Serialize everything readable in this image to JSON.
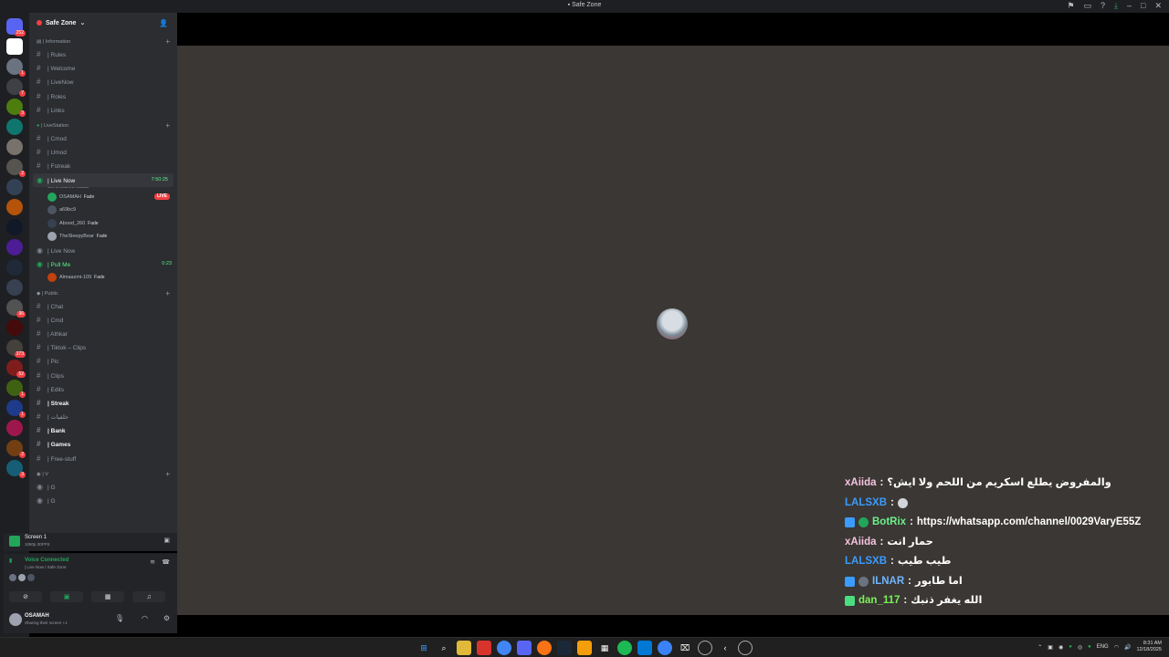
{
  "window": {
    "title": "Safe Zone",
    "title_icon": "discord-icon"
  },
  "server": {
    "name": "Safe Zone"
  },
  "servers_sidebar": {
    "badges": [
      "252",
      "1",
      "7",
      "3",
      "2",
      "96",
      "2",
      "373",
      "52",
      "1",
      "1",
      "2",
      "3"
    ]
  },
  "categories": {
    "information": {
      "label": "| Information"
    },
    "livestation": {
      "label": "| LiveStation"
    },
    "public": {
      "label": "| Public"
    },
    "v": {
      "label": "| V"
    }
  },
  "channels": {
    "rules": "| Rules",
    "welcome": "| Welcome",
    "livenow_text": "| LiveNow",
    "roles": "| Roles",
    "links": "| Links",
    "cmod": "| Cmod",
    "umod": "| Umod",
    "fstreak": "| Fstreak",
    "live_now_voice": "| Live Now",
    "live_now_status": "Set a channel status",
    "live_now_timer": "7:50:25",
    "live_now_2": "| Live Now",
    "pull_me": "| Pull Me",
    "pull_me_timer": "0:23",
    "chat": "| Chat",
    "cmd": "| Cmd",
    "athkar": "| Athkar",
    "tiktok": "| Tiktok – Clips",
    "pic": "| Pic",
    "clips": "| Clips",
    "edits": "| Edits",
    "streak": "| Streak",
    "arabic_channel": "| خلفيات",
    "bank": "| Bank",
    "games": "| Games",
    "free_stuff": "| Free-stuff",
    "g1": "| G",
    "g2": "| G"
  },
  "voice_users": {
    "u1": {
      "name": "OSAMAH",
      "tag": "Fade",
      "live": "LIVE"
    },
    "u2": {
      "name": "a69bc9",
      "tag": ""
    },
    "u3": {
      "name": "Abood_260",
      "tag": "Fade"
    },
    "u4": {
      "name": "TheSleepyBear",
      "tag": "Fade"
    },
    "u5": {
      "name": "Almaazmi-109",
      "tag": "Fade"
    }
  },
  "stream_panel": {
    "title": "Screen 1",
    "subtitle": "1080p 30FPS"
  },
  "voice_panel": {
    "status": "Voice Connected",
    "location": "| Live Now / Safe Zone"
  },
  "user_panel": {
    "username": "OSAMAH",
    "status": "Sharing their screen +1"
  },
  "stream_chat": [
    {
      "name": "xAiida",
      "name_color": "#f5c2e0",
      "text": "والمفروض يطلع اسكريم من اللحم ولا ايش؟"
    },
    {
      "name": "LALSXB",
      "name_color": "#3b9cff",
      "text": ""
    },
    {
      "name": "BotRix",
      "name_color": "#6df08a",
      "text": "https://whatsapp.com/channel/0029VaryE55Z"
    },
    {
      "name": "xAiida",
      "name_color": "#f5c2e0",
      "text": "حمار انت"
    },
    {
      "name": "LALSXB",
      "name_color": "#3b9cff",
      "text": "طيب طيب"
    },
    {
      "name": "ILNAR",
      "name_color": "#6fb6ff",
      "text": "اما طابور"
    },
    {
      "name": "dan_117",
      "name_color": "#7cf05a",
      "text": "الله يغفر ذنبك"
    }
  ],
  "taskbar": {
    "language": "ENG",
    "time": "8:31 AM",
    "date": "12/18/2025"
  },
  "colors": {
    "discord_bg": "#2b2d31",
    "server_bar": "#1e1f22",
    "live_red": "#f23f43",
    "voice_green": "#23a55a",
    "stream_bg": "#3a3734"
  }
}
